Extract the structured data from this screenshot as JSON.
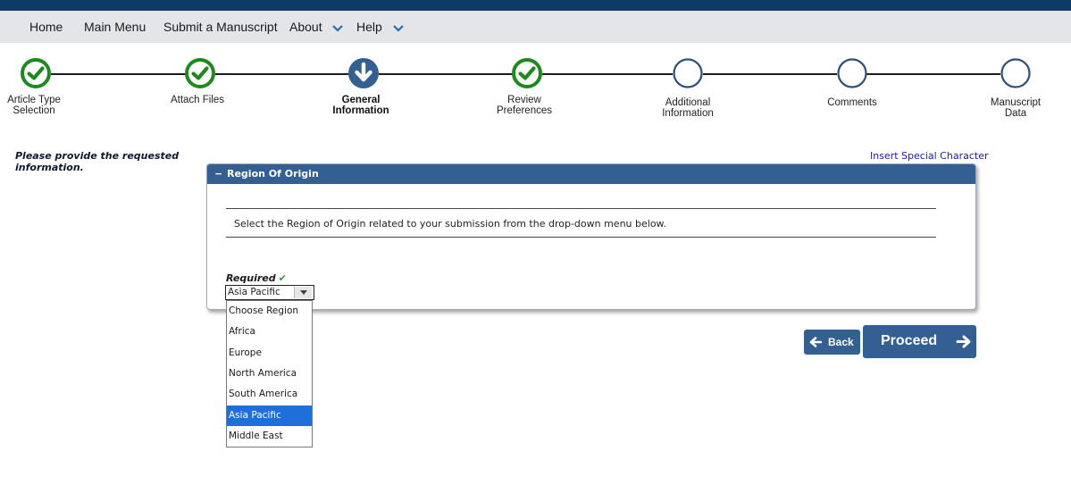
{
  "nav": {
    "items": [
      {
        "label": "Home",
        "has_menu": false
      },
      {
        "label": "Main Menu",
        "has_menu": false
      },
      {
        "label": "Submit a Manuscript",
        "has_menu": false
      },
      {
        "label": "About",
        "has_menu": true
      },
      {
        "label": "Help",
        "has_menu": true
      }
    ]
  },
  "steps": [
    {
      "label_1": "Article Type",
      "label_2": "Selection",
      "status": "complete"
    },
    {
      "label_1": "Attach Files",
      "label_2": "",
      "status": "complete"
    },
    {
      "label_1": "General",
      "label_2": "Information",
      "status": "current"
    },
    {
      "label_1": "Review",
      "label_2": "Preferences",
      "status": "complete"
    },
    {
      "label_1": "Additional",
      "label_2": "Information",
      "status": "pending"
    },
    {
      "label_1": "Comments",
      "label_2": "",
      "status": "pending"
    },
    {
      "label_1": "Manuscript",
      "label_2": "Data",
      "status": "pending"
    }
  ],
  "colors": {
    "complete": "#1e8a1e",
    "current": "#335f93",
    "pending": "#2c4f7c",
    "accent": "#335f93"
  },
  "main": {
    "instructions": "Please provide the requested information.",
    "special_char_link": "Insert Special Character",
    "panel": {
      "title": "Region Of Origin",
      "collapse_symbol": "−",
      "description": "Select the Region of Origin related to your submission from the drop-down menu below.",
      "required_label": "Required",
      "required_check": "✔"
    },
    "region_select": {
      "value": "Asia Pacific",
      "options": [
        "Choose Region",
        "Africa",
        "Europe",
        "North America",
        "South America",
        "Asia Pacific",
        "Middle East"
      ]
    }
  },
  "buttons": {
    "back": "Back",
    "proceed": "Proceed"
  }
}
